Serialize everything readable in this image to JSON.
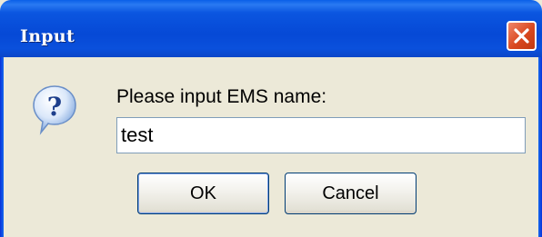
{
  "window": {
    "title": "Input",
    "close_icon": "close-icon"
  },
  "dialog": {
    "icon": "question-icon",
    "prompt": "Please input EMS name:",
    "input_value": "test",
    "ok_label": "OK",
    "cancel_label": "Cancel"
  },
  "colors": {
    "titlebar": "#0649d6",
    "close": "#d9481f",
    "background": "#ece9d8"
  }
}
